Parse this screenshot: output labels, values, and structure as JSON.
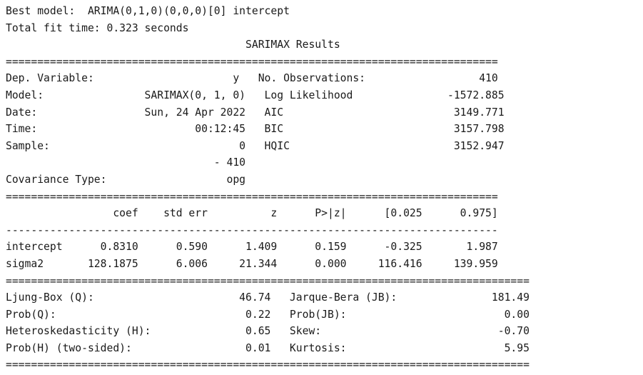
{
  "header": {
    "best_model": "Best model:  ARIMA(0,1,0)(0,0,0)[0] intercept",
    "fit_time": "Total fit time: 0.323 seconds",
    "title": "                                      SARIMAX Results"
  },
  "separators": {
    "double_narrow": "==============================================================================",
    "single_narrow": "------------------------------------------------------------------------------",
    "double_wide": "==================================================================================="
  },
  "model_summary": {
    "rows": [
      "Dep. Variable:                      y   No. Observations:                  410",
      "Model:                SARIMAX(0, 1, 0)   Log Likelihood               -1572.885",
      "Date:                 Sun, 24 Apr 2022   AIC                           3149.771",
      "Time:                         00:12:45   BIC                           3157.798",
      "Sample:                              0   HQIC                          3152.947",
      "                                 - 410",
      "Covariance Type:                   opg"
    ]
  },
  "coefficients": {
    "header": "                 coef    std err          z      P>|z|      [0.025      0.975]",
    "rows": [
      "intercept      0.8310      0.590      1.409      0.159      -0.325       1.987",
      "sigma2       128.1875      6.006     21.344      0.000     116.416     139.959"
    ]
  },
  "diagnostics": {
    "rows": [
      "Ljung-Box (Q):                       46.74   Jarque-Bera (JB):               181.49",
      "Prob(Q):                              0.22   Prob(JB):                         0.00",
      "Heteroskedasticity (H):               0.65   Skew:                            -0.70",
      "Prob(H) (two-sided):                  0.01   Kurtosis:                         5.95"
    ]
  }
}
